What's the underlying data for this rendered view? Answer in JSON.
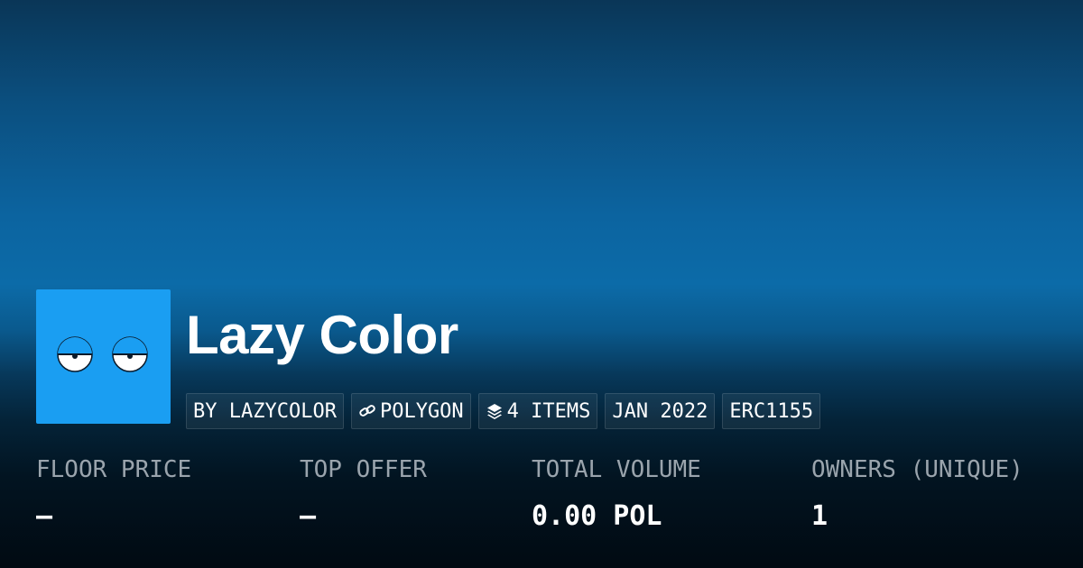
{
  "collection": {
    "name": "Lazy Color",
    "logo_icon": "sleepy-eyes-icon",
    "logo_bg": "#1a9ef2"
  },
  "tags": {
    "creator": "BY LAZYCOLOR",
    "chain": "POLYGON",
    "chain_icon": "polygon-link-icon",
    "items": "4 ITEMS",
    "items_icon": "layers-icon",
    "date": "JAN 2022",
    "standard": "ERC1155"
  },
  "stats": {
    "floor_price": {
      "label": "FLOOR PRICE",
      "value": "—"
    },
    "top_offer": {
      "label": "TOP OFFER",
      "value": "—"
    },
    "total_volume": {
      "label": "TOTAL VOLUME",
      "value": "0.00 POL"
    },
    "owners": {
      "label": "OWNERS (UNIQUE)",
      "value": "1"
    }
  }
}
